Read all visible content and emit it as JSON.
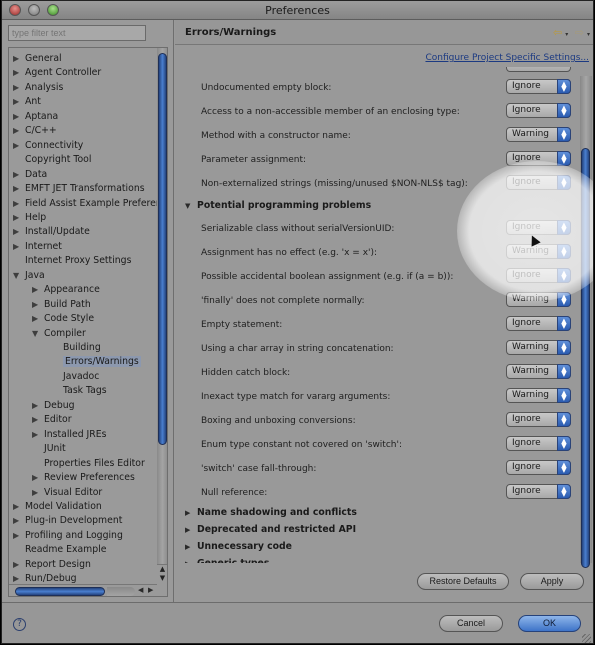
{
  "window": {
    "title": "Preferences"
  },
  "sidebar": {
    "filter_placeholder": "type filter text",
    "items": [
      {
        "label": "General",
        "arrow": "▶",
        "level": 0
      },
      {
        "label": "Agent Controller",
        "arrow": "▶",
        "level": 0
      },
      {
        "label": "Analysis",
        "arrow": "▶",
        "level": 0
      },
      {
        "label": "Ant",
        "arrow": "▶",
        "level": 0
      },
      {
        "label": "Aptana",
        "arrow": "▶",
        "level": 0
      },
      {
        "label": "C/C++",
        "arrow": "▶",
        "level": 0
      },
      {
        "label": "Connectivity",
        "arrow": "▶",
        "level": 0
      },
      {
        "label": "Copyright Tool",
        "arrow": "",
        "level": 0
      },
      {
        "label": "Data",
        "arrow": "▶",
        "level": 0
      },
      {
        "label": "EMFT JET Transformations",
        "arrow": "▶",
        "level": 0
      },
      {
        "label": "Field Assist Example Preferences",
        "arrow": "▶",
        "level": 0
      },
      {
        "label": "Help",
        "arrow": "▶",
        "level": 0
      },
      {
        "label": "Install/Update",
        "arrow": "▶",
        "level": 0
      },
      {
        "label": "Internet",
        "arrow": "▶",
        "level": 0
      },
      {
        "label": "Internet Proxy Settings",
        "arrow": "",
        "level": 0
      },
      {
        "label": "Java",
        "arrow": "▼",
        "level": 0
      },
      {
        "label": "Appearance",
        "arrow": "▶",
        "level": 1
      },
      {
        "label": "Build Path",
        "arrow": "▶",
        "level": 1
      },
      {
        "label": "Code Style",
        "arrow": "▶",
        "level": 1
      },
      {
        "label": "Compiler",
        "arrow": "▼",
        "level": 1
      },
      {
        "label": "Building",
        "arrow": "",
        "level": 2
      },
      {
        "label": "Errors/Warnings",
        "arrow": "",
        "level": 2,
        "selected": true
      },
      {
        "label": "Javadoc",
        "arrow": "",
        "level": 2
      },
      {
        "label": "Task Tags",
        "arrow": "",
        "level": 2
      },
      {
        "label": "Debug",
        "arrow": "▶",
        "level": 1
      },
      {
        "label": "Editor",
        "arrow": "▶",
        "level": 1
      },
      {
        "label": "Installed JREs",
        "arrow": "▶",
        "level": 1
      },
      {
        "label": "JUnit",
        "arrow": "",
        "level": 1
      },
      {
        "label": "Properties Files Editor",
        "arrow": "",
        "level": 1
      },
      {
        "label": "Review Preferences",
        "arrow": "▶",
        "level": 1
      },
      {
        "label": "Visual Editor",
        "arrow": "▶",
        "level": 1
      },
      {
        "label": "Model Validation",
        "arrow": "▶",
        "level": 0
      },
      {
        "label": "Plug-in Development",
        "arrow": "▶",
        "level": 0
      },
      {
        "label": "Profiling and Logging",
        "arrow": "▶",
        "level": 0
      },
      {
        "label": "Readme Example",
        "arrow": "",
        "level": 0
      },
      {
        "label": "Report Design",
        "arrow": "▶",
        "level": 0
      },
      {
        "label": "Run/Debug",
        "arrow": "▶",
        "level": 0
      }
    ]
  },
  "main": {
    "title": "Errors/Warnings",
    "configure_link": "Configure Project Specific Settings...",
    "rows_top": [
      {
        "label": "Undocumented empty block:",
        "value": "Ignore"
      },
      {
        "label": "Access to a non-accessible member of an enclosing type:",
        "value": "Ignore"
      },
      {
        "label": "Method with a constructor name:",
        "value": "Warning"
      },
      {
        "label": "Parameter assignment:",
        "value": "Ignore"
      },
      {
        "label": "Non-externalized strings (missing/unused $NON-NLS$ tag):",
        "value": "Ignore"
      }
    ],
    "section_expanded": {
      "label": "Potential programming problems",
      "arrow": "▼"
    },
    "rows_potential": [
      {
        "label": "Serializable class without serialVersionUID:",
        "value": "Ignore"
      },
      {
        "label": "Assignment has no effect (e.g. 'x = x'):",
        "value": "Warning"
      },
      {
        "label": "Possible accidental boolean assignment (e.g. if (a = b)):",
        "value": "Ignore"
      },
      {
        "label": "'finally' does not complete normally:",
        "value": "Warning"
      },
      {
        "label": "Empty statement:",
        "value": "Ignore"
      },
      {
        "label": "Using a char array in string concatenation:",
        "value": "Warning"
      },
      {
        "label": "Hidden catch block:",
        "value": "Warning"
      },
      {
        "label": "Inexact type match for vararg arguments:",
        "value": "Warning"
      },
      {
        "label": "Boxing and unboxing conversions:",
        "value": "Ignore"
      },
      {
        "label": "Enum type constant not covered on 'switch':",
        "value": "Ignore"
      },
      {
        "label": "'switch' case fall-through:",
        "value": "Ignore"
      },
      {
        "label": "Null reference:",
        "value": "Ignore"
      }
    ],
    "sections_collapsed": [
      {
        "label": "Name shadowing and conflicts",
        "arrow": "▶"
      },
      {
        "label": "Deprecated and restricted API",
        "arrow": "▶"
      },
      {
        "label": "Unnecessary code",
        "arrow": "▶"
      },
      {
        "label": "Generic types",
        "arrow": "▶"
      }
    ],
    "restore_defaults": "Restore Defaults",
    "apply": "Apply"
  },
  "footer": {
    "cancel": "Cancel",
    "ok": "OK",
    "help_icon": "?"
  },
  "icons": {
    "nav_back": "⇦",
    "nav_forward": "⇨",
    "dropdown": "▾",
    "select_knob": "▴▾"
  }
}
